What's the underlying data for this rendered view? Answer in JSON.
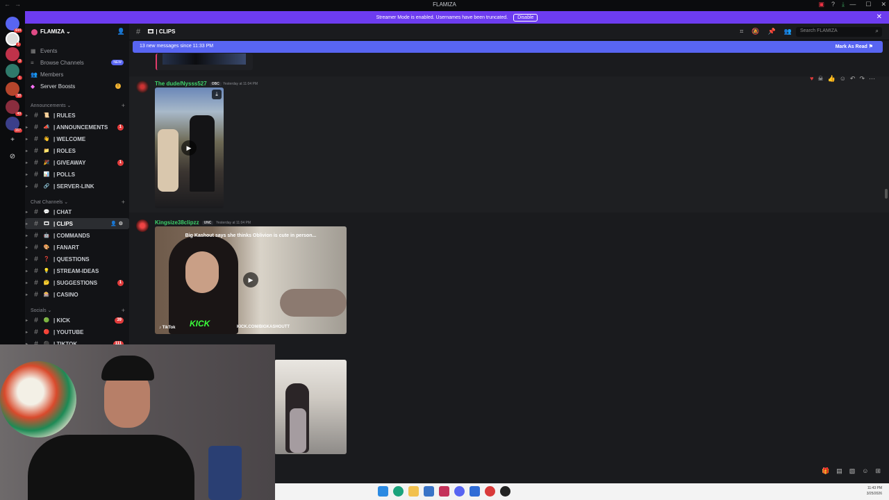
{
  "window": {
    "title": "FLAMIZA"
  },
  "banner": {
    "text": "Streamer Mode is enabled. Usernames have been truncated.",
    "button": "Disable"
  },
  "server": {
    "name": "FLAMIZA"
  },
  "server_badges": [
    "444",
    "1",
    "3",
    "1",
    "38",
    "49",
    "167"
  ],
  "nav": [
    {
      "label": "Events",
      "icon": "calendar-icon"
    },
    {
      "label": "Browse Channels",
      "icon": "browse-icon",
      "pill": "NEW"
    },
    {
      "label": "Members",
      "icon": "members-icon"
    },
    {
      "label": "Server Boosts",
      "icon": "boost-icon",
      "pill": "!"
    }
  ],
  "categories": {
    "announcements": "Announcements",
    "chat": "Chat Channels",
    "socials": "Socials"
  },
  "channels": {
    "announcements": [
      {
        "name": "| RULES",
        "emoji": "📜"
      },
      {
        "name": "| ANNOUNCEMENTS",
        "emoji": "📣",
        "badge": "1"
      },
      {
        "name": "| WELCOME",
        "emoji": "👋"
      },
      {
        "name": "| ROLES",
        "emoji": "📁"
      },
      {
        "name": "| GIVEAWAY",
        "emoji": "🎉",
        "badge": "1"
      },
      {
        "name": "| POLLS",
        "emoji": "📊"
      },
      {
        "name": "| SERVER-LINK",
        "emoji": "🔗"
      }
    ],
    "chat": [
      {
        "name": "| CHAT",
        "emoji": "💬"
      },
      {
        "name": "| CLIPS",
        "emoji": "🎞",
        "active": true
      },
      {
        "name": "| COMMANDS",
        "emoji": "🤖"
      },
      {
        "name": "| FANART",
        "emoji": "🎨"
      },
      {
        "name": "| QUESTIONS",
        "emoji": "❓"
      },
      {
        "name": "| STREAM-IDEAS",
        "emoji": "💡"
      },
      {
        "name": "| SUGGESTIONS",
        "emoji": "🤔",
        "badge": "1"
      },
      {
        "name": "| CASINO",
        "emoji": "🎰"
      }
    ],
    "socials": [
      {
        "name": "| KICK",
        "emoji": "🟢",
        "badge": "39"
      },
      {
        "name": "| YOUTUBE",
        "emoji": "🔴"
      },
      {
        "name": "| TIKTOK",
        "emoji": "⚫",
        "badge": "111"
      }
    ]
  },
  "header": {
    "channel": "| CLIPS",
    "search_placeholder": "Search FLAMIZA"
  },
  "new_messages": {
    "text": "13 new messages since 11:33 PM",
    "action": "Mark As Read"
  },
  "messages": [
    {
      "author": "The dude/Nysss527",
      "tag": "OBC",
      "time": "Yesterday at 11:04 PM",
      "color": "#3ed16a"
    },
    {
      "author": "Kingsize38clipzz",
      "tag": "UNC",
      "time": "Yesterday at 11:04 PM",
      "color": "#3ed16a",
      "caption": "Big Kashout says she thinks Oblivion is cute in person...",
      "tiktok": "TikTok",
      "kick_logo": "KICK",
      "kick_url": "KICK.COM/BIGKASHOUTT"
    }
  ],
  "taskbar": {
    "time": "11:43 PM",
    "date": "3/25/2026"
  }
}
